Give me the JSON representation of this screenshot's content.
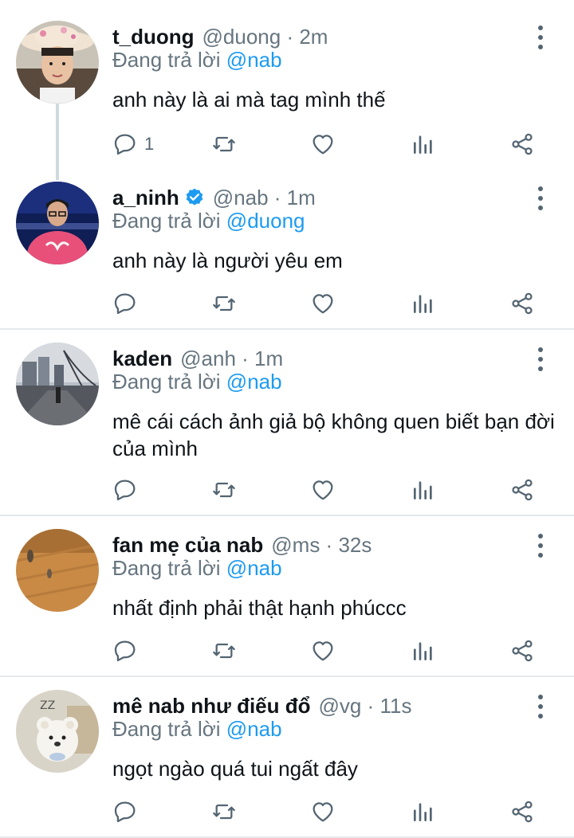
{
  "replying_label": "Đang trả lời",
  "colors": {
    "accent": "#1d9bf0",
    "muted": "#66757f",
    "verified": "#1d9bf0",
    "divider": "#e6e9ec"
  },
  "tweets": [
    {
      "name": "t_duong",
      "meta": "@duong · 2m",
      "reply_to": "@nab",
      "text": "anh này là ai mà tag mình thế",
      "reply_count": "1",
      "verified": false,
      "avatar_icon": "avatar-hat-boy"
    },
    {
      "name": "a_ninh",
      "meta": "@nab · 1m",
      "reply_to": "@duong",
      "text": "anh này là người yêu em",
      "reply_count": "",
      "verified": true,
      "avatar_icon": "avatar-pink-shirt"
    },
    {
      "name": "kaden",
      "meta": "@anh · 1m",
      "reply_to": "@nab",
      "text": "mê cái cách ảnh giả bộ không quen biết bạn đời của mình",
      "reply_count": "",
      "verified": false,
      "avatar_icon": "avatar-city-bridge"
    },
    {
      "name": "fan mẹ của nab",
      "meta": "@ms · 32s",
      "reply_to": "@nab",
      "text": "nhất định phải thật hạnh phúccc",
      "reply_count": "",
      "verified": false,
      "avatar_icon": "avatar-wood-floor"
    },
    {
      "name": "mê nab như điếu đổ",
      "meta": "@vg · 11s",
      "reply_to": "@nab",
      "text": "ngọt ngào quá tui ngất đây",
      "reply_count": "",
      "verified": false,
      "avatar_icon": "avatar-teddy-bear"
    }
  ]
}
